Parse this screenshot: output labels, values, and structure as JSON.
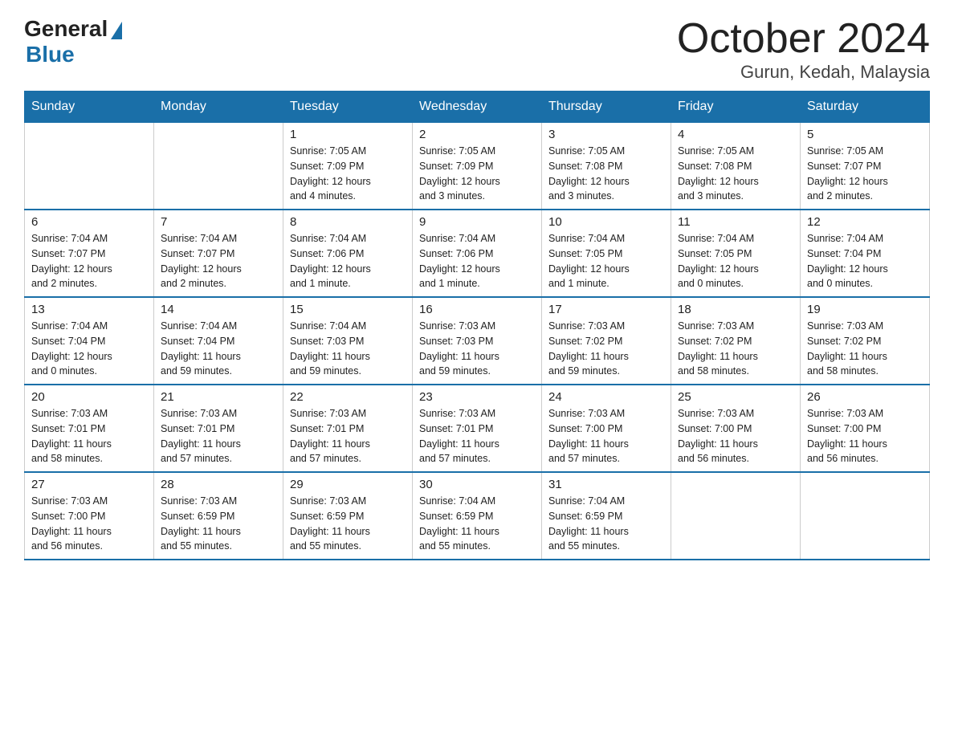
{
  "header": {
    "logo_general": "General",
    "logo_blue": "Blue",
    "title": "October 2024",
    "subtitle": "Gurun, Kedah, Malaysia"
  },
  "days_of_week": [
    "Sunday",
    "Monday",
    "Tuesday",
    "Wednesday",
    "Thursday",
    "Friday",
    "Saturday"
  ],
  "weeks": [
    [
      {
        "day": "",
        "info": ""
      },
      {
        "day": "",
        "info": ""
      },
      {
        "day": "1",
        "info": "Sunrise: 7:05 AM\nSunset: 7:09 PM\nDaylight: 12 hours\nand 4 minutes."
      },
      {
        "day": "2",
        "info": "Sunrise: 7:05 AM\nSunset: 7:09 PM\nDaylight: 12 hours\nand 3 minutes."
      },
      {
        "day": "3",
        "info": "Sunrise: 7:05 AM\nSunset: 7:08 PM\nDaylight: 12 hours\nand 3 minutes."
      },
      {
        "day": "4",
        "info": "Sunrise: 7:05 AM\nSunset: 7:08 PM\nDaylight: 12 hours\nand 3 minutes."
      },
      {
        "day": "5",
        "info": "Sunrise: 7:05 AM\nSunset: 7:07 PM\nDaylight: 12 hours\nand 2 minutes."
      }
    ],
    [
      {
        "day": "6",
        "info": "Sunrise: 7:04 AM\nSunset: 7:07 PM\nDaylight: 12 hours\nand 2 minutes."
      },
      {
        "day": "7",
        "info": "Sunrise: 7:04 AM\nSunset: 7:07 PM\nDaylight: 12 hours\nand 2 minutes."
      },
      {
        "day": "8",
        "info": "Sunrise: 7:04 AM\nSunset: 7:06 PM\nDaylight: 12 hours\nand 1 minute."
      },
      {
        "day": "9",
        "info": "Sunrise: 7:04 AM\nSunset: 7:06 PM\nDaylight: 12 hours\nand 1 minute."
      },
      {
        "day": "10",
        "info": "Sunrise: 7:04 AM\nSunset: 7:05 PM\nDaylight: 12 hours\nand 1 minute."
      },
      {
        "day": "11",
        "info": "Sunrise: 7:04 AM\nSunset: 7:05 PM\nDaylight: 12 hours\nand 0 minutes."
      },
      {
        "day": "12",
        "info": "Sunrise: 7:04 AM\nSunset: 7:04 PM\nDaylight: 12 hours\nand 0 minutes."
      }
    ],
    [
      {
        "day": "13",
        "info": "Sunrise: 7:04 AM\nSunset: 7:04 PM\nDaylight: 12 hours\nand 0 minutes."
      },
      {
        "day": "14",
        "info": "Sunrise: 7:04 AM\nSunset: 7:04 PM\nDaylight: 11 hours\nand 59 minutes."
      },
      {
        "day": "15",
        "info": "Sunrise: 7:04 AM\nSunset: 7:03 PM\nDaylight: 11 hours\nand 59 minutes."
      },
      {
        "day": "16",
        "info": "Sunrise: 7:03 AM\nSunset: 7:03 PM\nDaylight: 11 hours\nand 59 minutes."
      },
      {
        "day": "17",
        "info": "Sunrise: 7:03 AM\nSunset: 7:02 PM\nDaylight: 11 hours\nand 59 minutes."
      },
      {
        "day": "18",
        "info": "Sunrise: 7:03 AM\nSunset: 7:02 PM\nDaylight: 11 hours\nand 58 minutes."
      },
      {
        "day": "19",
        "info": "Sunrise: 7:03 AM\nSunset: 7:02 PM\nDaylight: 11 hours\nand 58 minutes."
      }
    ],
    [
      {
        "day": "20",
        "info": "Sunrise: 7:03 AM\nSunset: 7:01 PM\nDaylight: 11 hours\nand 58 minutes."
      },
      {
        "day": "21",
        "info": "Sunrise: 7:03 AM\nSunset: 7:01 PM\nDaylight: 11 hours\nand 57 minutes."
      },
      {
        "day": "22",
        "info": "Sunrise: 7:03 AM\nSunset: 7:01 PM\nDaylight: 11 hours\nand 57 minutes."
      },
      {
        "day": "23",
        "info": "Sunrise: 7:03 AM\nSunset: 7:01 PM\nDaylight: 11 hours\nand 57 minutes."
      },
      {
        "day": "24",
        "info": "Sunrise: 7:03 AM\nSunset: 7:00 PM\nDaylight: 11 hours\nand 57 minutes."
      },
      {
        "day": "25",
        "info": "Sunrise: 7:03 AM\nSunset: 7:00 PM\nDaylight: 11 hours\nand 56 minutes."
      },
      {
        "day": "26",
        "info": "Sunrise: 7:03 AM\nSunset: 7:00 PM\nDaylight: 11 hours\nand 56 minutes."
      }
    ],
    [
      {
        "day": "27",
        "info": "Sunrise: 7:03 AM\nSunset: 7:00 PM\nDaylight: 11 hours\nand 56 minutes."
      },
      {
        "day": "28",
        "info": "Sunrise: 7:03 AM\nSunset: 6:59 PM\nDaylight: 11 hours\nand 55 minutes."
      },
      {
        "day": "29",
        "info": "Sunrise: 7:03 AM\nSunset: 6:59 PM\nDaylight: 11 hours\nand 55 minutes."
      },
      {
        "day": "30",
        "info": "Sunrise: 7:04 AM\nSunset: 6:59 PM\nDaylight: 11 hours\nand 55 minutes."
      },
      {
        "day": "31",
        "info": "Sunrise: 7:04 AM\nSunset: 6:59 PM\nDaylight: 11 hours\nand 55 minutes."
      },
      {
        "day": "",
        "info": ""
      },
      {
        "day": "",
        "info": ""
      }
    ]
  ]
}
